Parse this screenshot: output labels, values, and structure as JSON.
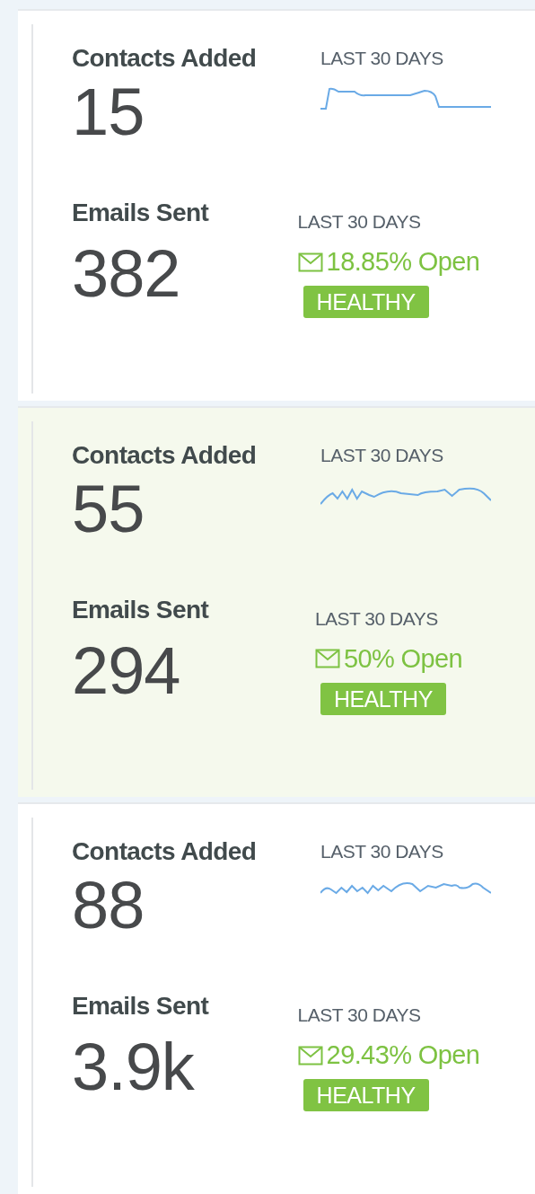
{
  "cards": [
    {
      "selected": false,
      "contacts": {
        "label": "Contacts Added",
        "period": "LAST 30 DAYS",
        "value": "15"
      },
      "emails": {
        "label": "Emails Sent",
        "value": "382",
        "period": "LAST 30 DAYS",
        "open_rate": "18.85% Open",
        "status": "HEALTHY"
      }
    },
    {
      "selected": true,
      "contacts": {
        "label": "Contacts Added",
        "period": "LAST 30 DAYS",
        "value": "55"
      },
      "emails": {
        "label": "Emails Sent",
        "value": "294",
        "period": "LAST 30 DAYS",
        "open_rate": "50% Open",
        "status": "HEALTHY"
      }
    },
    {
      "selected": false,
      "contacts": {
        "label": "Contacts Added",
        "period": "LAST 30 DAYS",
        "value": "88"
      },
      "emails": {
        "label": "Emails Sent",
        "value": "3.9k",
        "period": "LAST 30 DAYS",
        "open_rate": "29.43% Open",
        "status": "HEALTHY"
      }
    }
  ]
}
